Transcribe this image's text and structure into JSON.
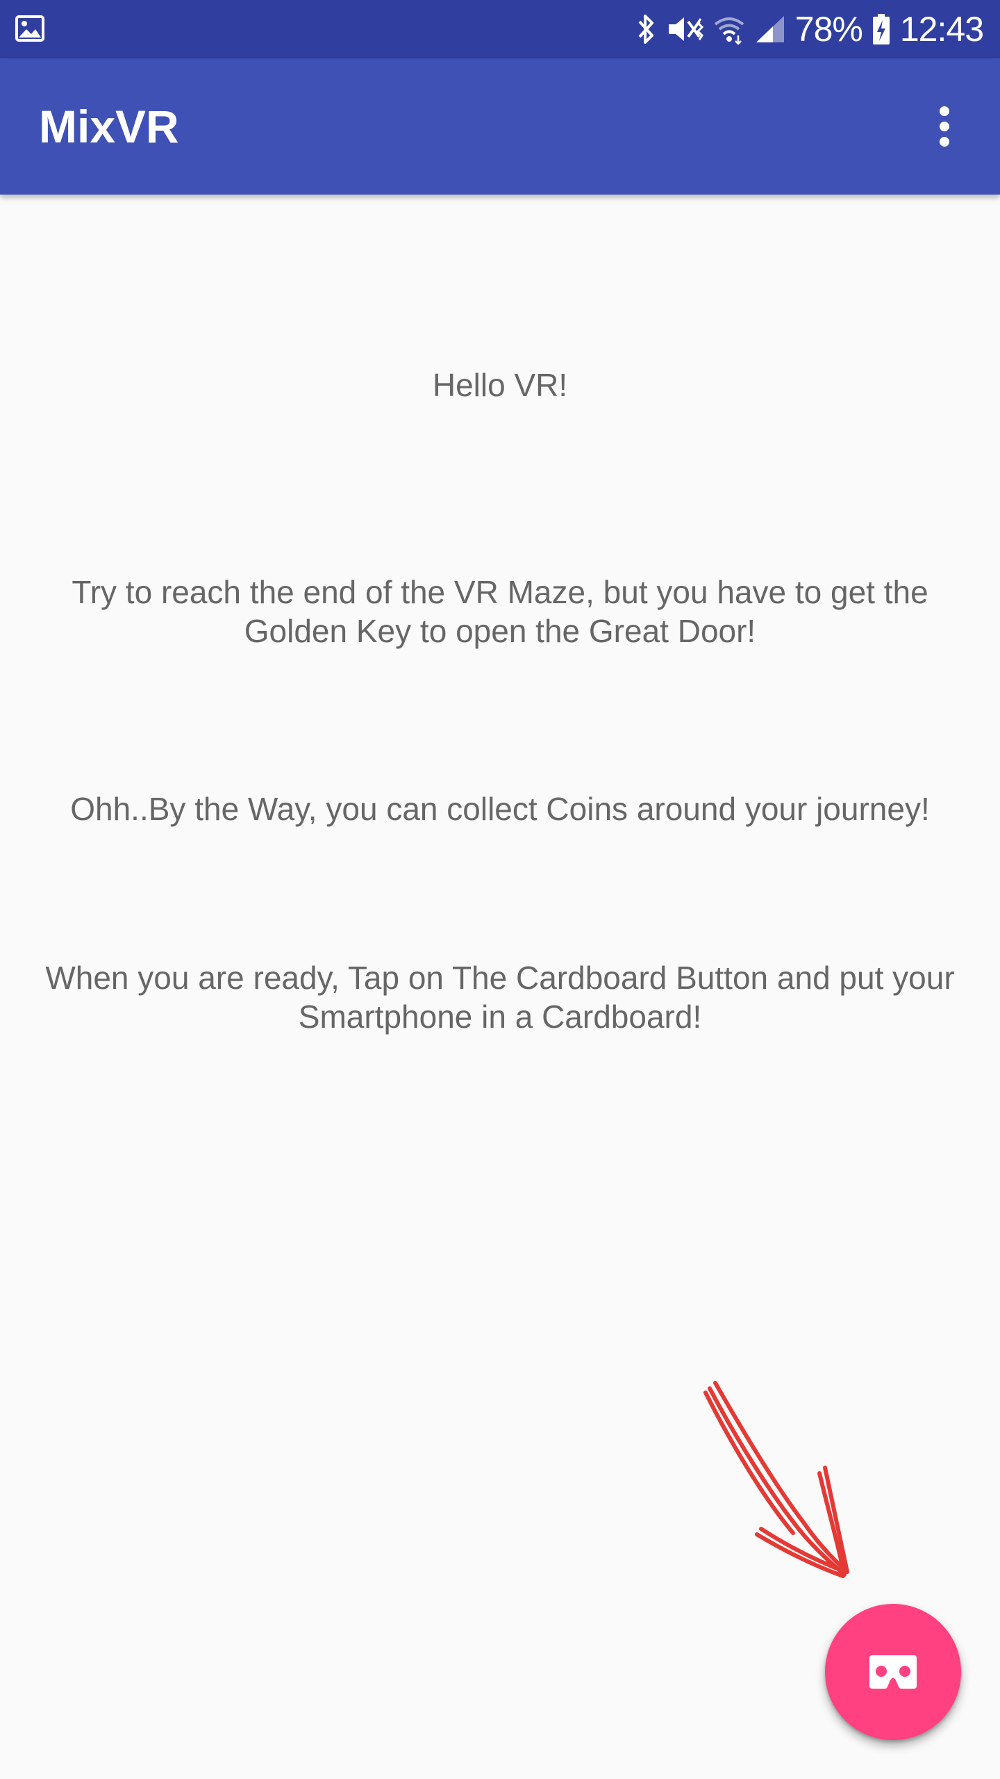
{
  "status_bar": {
    "battery_percent": "78%",
    "time": "12:43",
    "icons": [
      "image-notification-icon",
      "bluetooth-icon",
      "vibrate-mute-icon",
      "wifi-icon",
      "cellular-signal-icon",
      "battery-charging-icon"
    ]
  },
  "app_bar": {
    "title": "MixVR",
    "overflow_icon": "more-vert-icon"
  },
  "content": {
    "greeting": "Hello VR!",
    "instruction_goal": "Try to reach the end of the VR Maze, but you have to get the Golden Key to open the Great Door!",
    "instruction_coins": "Ohh..By the Way, you can collect Coins around your journey!",
    "instruction_start": "When you are ready, Tap on The Cardboard Button and put your Smartphone in a Cardboard!"
  },
  "fab": {
    "icon": "cardboard-vr-icon",
    "color": "#ff4081"
  },
  "colors": {
    "status_bar": "#303f9f",
    "app_bar": "#3f51b5",
    "background": "#fafafa",
    "text": "#666666",
    "annotation": "#e53935"
  }
}
